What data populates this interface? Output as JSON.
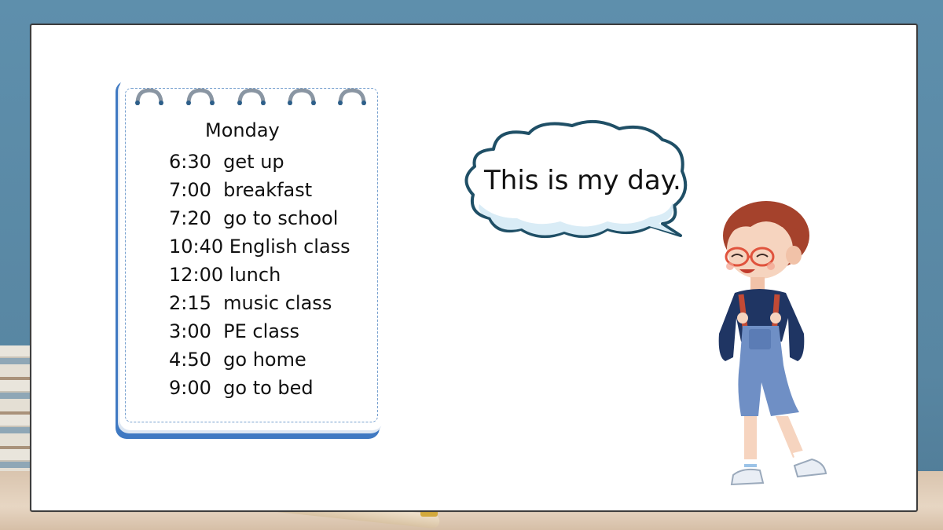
{
  "schedule": {
    "title": "Monday",
    "items": [
      {
        "text": "6:30  get up"
      },
      {
        "text": "7:00  breakfast"
      },
      {
        "text": "7:20  go to school"
      },
      {
        "text": "10:40 English class"
      },
      {
        "text": "12:00 lunch"
      },
      {
        "text": "2:15  music class"
      },
      {
        "text": "3:00  PE class"
      },
      {
        "text": "4:50  go home"
      },
      {
        "text": "9:00  go to bed"
      }
    ]
  },
  "bubble": {
    "text": "This is my day."
  },
  "colors": {
    "notepad_blue": "#3f79c2",
    "bubble_outline": "#1f4f66",
    "bubble_fill": "#d9ecf6",
    "background_wall": "#5b8aa5"
  }
}
